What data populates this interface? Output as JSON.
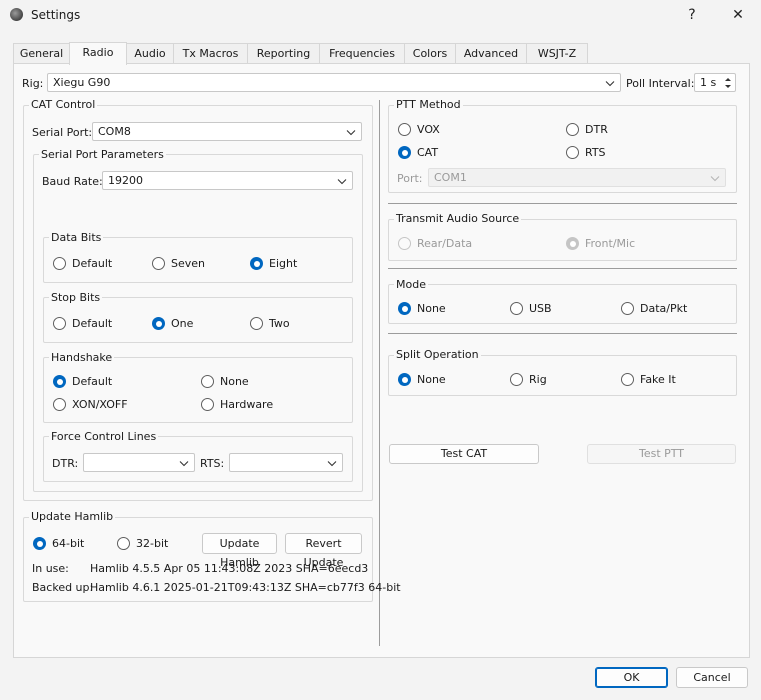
{
  "window": {
    "title": "Settings",
    "help_glyph": "?",
    "close_glyph": "✕"
  },
  "tabs": [
    "General",
    "Radio",
    "Audio",
    "Tx Macros",
    "Reporting",
    "Frequencies",
    "Colors",
    "Advanced",
    "WSJT-Z"
  ],
  "rig": {
    "label": "Rig:",
    "value": "Xiegu G90",
    "poll_label": "Poll Interval:",
    "poll_value": "1 s"
  },
  "cat": {
    "title": "CAT Control",
    "serial_port_label": "Serial Port:",
    "serial_port_value": "COM8",
    "params_title": "Serial Port Parameters",
    "baud_label": "Baud Rate:",
    "baud_value": "19200",
    "data_bits": {
      "title": "Data Bits",
      "options": [
        "Default",
        "Seven",
        "Eight"
      ],
      "selected": "Eight"
    },
    "stop_bits": {
      "title": "Stop Bits",
      "options": [
        "Default",
        "One",
        "Two"
      ],
      "selected": "One"
    },
    "handshake": {
      "title": "Handshake",
      "options": [
        "Default",
        "None",
        "XON/XOFF",
        "Hardware"
      ],
      "selected": "Default"
    },
    "force": {
      "title": "Force Control Lines",
      "dtr_label": "DTR:",
      "dtr_value": "",
      "rts_label": "RTS:",
      "rts_value": ""
    }
  },
  "ptt": {
    "title": "PTT Method",
    "options": [
      "VOX",
      "DTR",
      "CAT",
      "RTS"
    ],
    "selected": "CAT",
    "port_label": "Port:",
    "port_value": "COM1"
  },
  "audio_source": {
    "title": "Transmit Audio Source",
    "options": [
      "Rear/Data",
      "Front/Mic"
    ],
    "selected": "Front/Mic"
  },
  "mode": {
    "title": "Mode",
    "options": [
      "None",
      "USB",
      "Data/Pkt"
    ],
    "selected": "None"
  },
  "split": {
    "title": "Split Operation",
    "options": [
      "None",
      "Rig",
      "Fake It"
    ],
    "selected": "None"
  },
  "buttons": {
    "test_cat": "Test CAT",
    "test_ptt": "Test PTT",
    "ok": "OK",
    "cancel": "Cancel"
  },
  "hamlib": {
    "title": "Update Hamlib",
    "bits_options": [
      "64-bit",
      "32-bit"
    ],
    "bits_selected": "64-bit",
    "update_btn": "Update Hamlib",
    "revert_btn": "Revert Update",
    "in_use_label": "In use:",
    "in_use_value": "Hamlib 4.5.5 Apr 05 11:43:08Z 2023 SHA=6eecd3",
    "backed_label": "Backed up:",
    "backed_value": "Hamlib 4.6.1 2025-01-21T09:43:13Z SHA=cb77f3 64-bit"
  },
  "colors": {
    "accent": "#0067c0",
    "background": "#f3f3f3",
    "panel": "#f9f9f9"
  }
}
